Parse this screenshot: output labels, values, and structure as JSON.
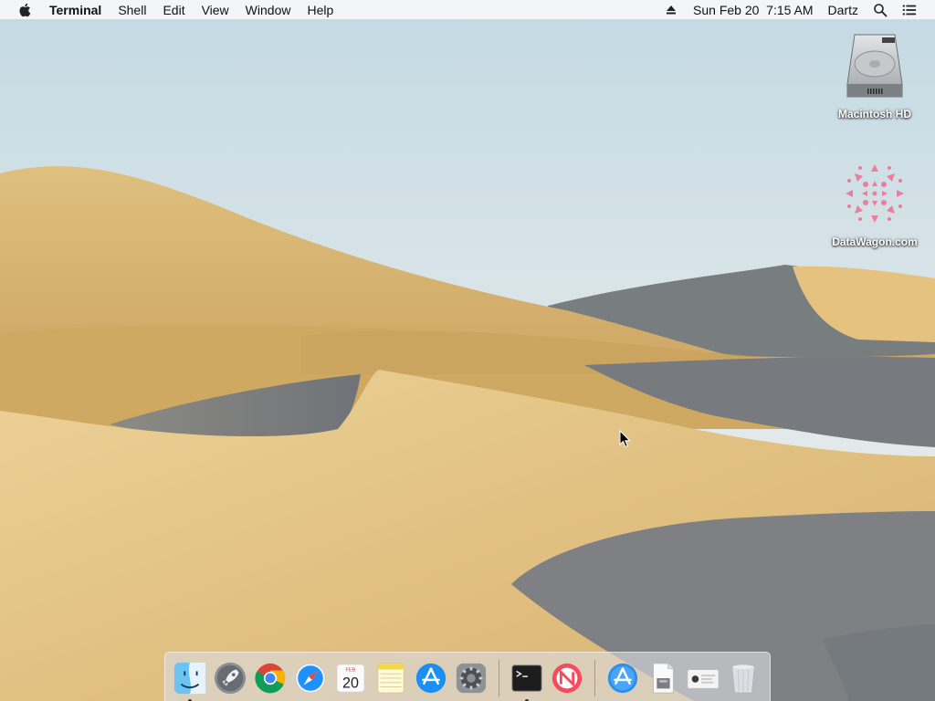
{
  "menubar": {
    "apple_icon": "apple-logo-icon",
    "app_name": "Terminal",
    "menus": [
      "Shell",
      "Edit",
      "View",
      "Window",
      "Help"
    ],
    "status": {
      "eject_icon": "eject-icon",
      "datetime": "Sun Feb 20  7:15 AM",
      "user": "Dartz",
      "search_icon": "search-icon",
      "notification_icon": "notification-center-icon"
    }
  },
  "desktop": {
    "icons": [
      {
        "label": "Macintosh HD",
        "icon": "hard-drive-icon"
      },
      {
        "label": "DataWagon.com",
        "icon": "pink-pattern-icon"
      }
    ]
  },
  "dock": {
    "calendar": {
      "month": "FEB",
      "day": "20"
    },
    "items": [
      {
        "name": "Finder",
        "icon": "finder-icon",
        "running": true
      },
      {
        "name": "Launchpad",
        "icon": "launchpad-icon",
        "running": false
      },
      {
        "name": "Google Chrome",
        "icon": "chrome-icon",
        "running": false
      },
      {
        "name": "Safari",
        "icon": "safari-icon",
        "running": false
      },
      {
        "name": "Calendar",
        "icon": "calendar-icon",
        "running": false
      },
      {
        "name": "Notes",
        "icon": "notes-icon",
        "running": false
      },
      {
        "name": "App Store",
        "icon": "app-store-icon",
        "running": false
      },
      {
        "name": "System Preferences",
        "icon": "system-preferences-icon",
        "running": false
      },
      {
        "name": "Terminal",
        "icon": "terminal-icon",
        "running": true
      },
      {
        "name": "News",
        "icon": "news-icon",
        "running": false
      },
      {
        "name": "Applications",
        "icon": "applications-folder-icon",
        "running": false
      },
      {
        "name": "Document",
        "icon": "document-icon",
        "running": false
      },
      {
        "name": "Screenshot",
        "icon": "screenshot-icon",
        "running": false
      },
      {
        "name": "Trash",
        "icon": "trash-icon",
        "running": false
      }
    ]
  },
  "colors": {
    "sky_top": "#c9dde6",
    "sky_bottom": "#e9ecea",
    "sand_light": "#e6c787",
    "sand_mid": "#d2ae6b",
    "dune_shadow": "#7f8387",
    "accent_blue": "#1b8ff2"
  }
}
